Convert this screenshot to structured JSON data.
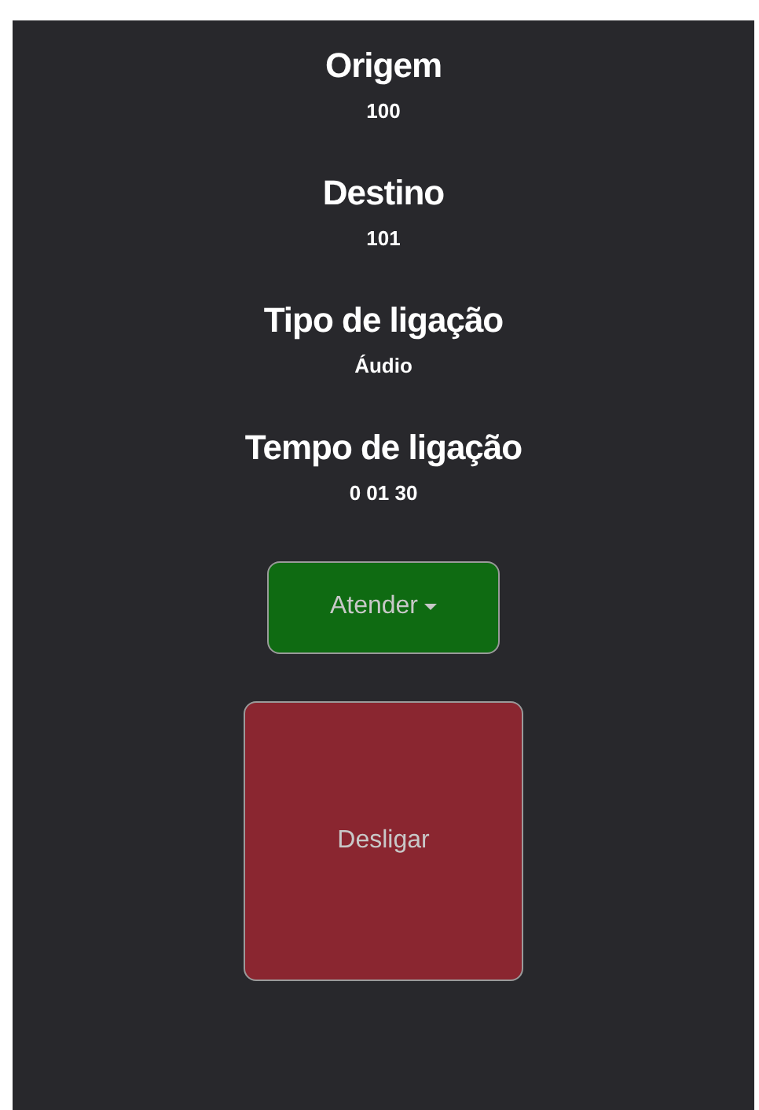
{
  "fields": [
    {
      "label": "Origem",
      "value": "100"
    },
    {
      "label": "Destino",
      "value": "101"
    },
    {
      "label": "Tipo de ligação",
      "value": "Áudio"
    },
    {
      "label": "Tempo de ligação",
      "value": "0 01 30"
    }
  ],
  "actions": [
    {
      "label": "Atender",
      "kind": "dropdown",
      "color": "#0f6b12"
    },
    {
      "label": "Desligar",
      "kind": "large",
      "color": "#8a2630"
    }
  ]
}
